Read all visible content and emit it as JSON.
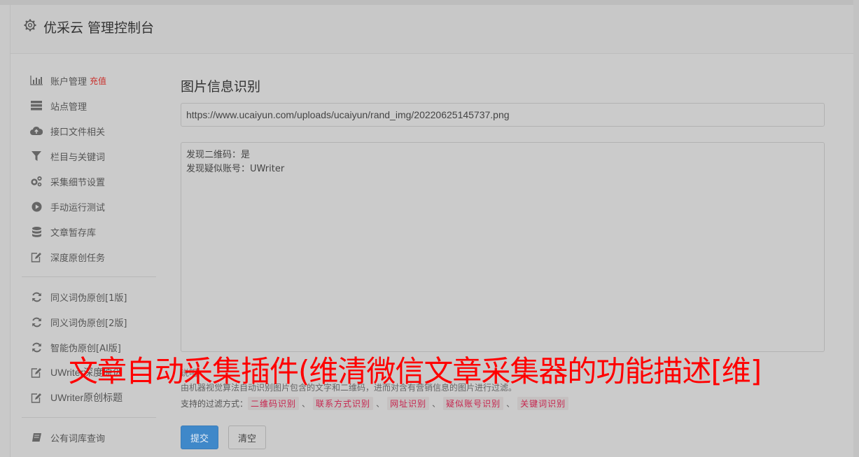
{
  "header": {
    "title": "优采云 管理控制台"
  },
  "sidebar": {
    "items": [
      {
        "label": "账户管理",
        "badge": "充值",
        "icon": "bar-chart-icon"
      },
      {
        "label": "站点管理",
        "icon": "server-icon"
      },
      {
        "label": "接口文件相关",
        "icon": "cloud-upload-icon"
      },
      {
        "label": "栏目与关键词",
        "icon": "filter-icon"
      },
      {
        "label": "采集细节设置",
        "icon": "gears-icon"
      },
      {
        "label": "手动运行测试",
        "icon": "play-circle-icon"
      },
      {
        "label": "文章暂存库",
        "icon": "database-icon"
      },
      {
        "label": "深度原创任务",
        "icon": "edit-icon"
      },
      {
        "label": "同义词伪原创[1版]",
        "icon": "refresh-icon"
      },
      {
        "label": "同义词伪原创[2版]",
        "icon": "refresh-icon"
      },
      {
        "label": "智能伪原创[AI版]",
        "icon": "refresh-icon"
      },
      {
        "label": "UWriter深度原创",
        "icon": "edit-icon"
      },
      {
        "label": "UWriter原创标题",
        "icon": "edit-icon"
      },
      {
        "label": "公有词库查询",
        "icon": "book-icon"
      }
    ]
  },
  "main": {
    "title": "图片信息识别",
    "url_value": "https://www.ucaiyun.com/uploads/ucaiyun/rand_img/20220625145737.png",
    "result_lines": [
      "发现二维码：是",
      "发现疑似账号：UWriter"
    ],
    "desc_label": "说明",
    "desc_text": "由机器视觉算法自动识别图片包含的文字和二维码，进而对含有营销信息的图片进行过滤。",
    "filter_label": "支持的过滤方式：",
    "filter_tags": [
      "二维码识别",
      "联系方式识别",
      "网址识别",
      "疑似账号识别",
      "关键词识别"
    ],
    "filter_sep": "、",
    "submit_label": "提交",
    "clear_label": "清空"
  },
  "watermark": "文章自动采集插件(维清微信文章采集器的功能描述[维]",
  "colors": {
    "primary_button": "#3f88c9",
    "badge_red": "#c9302c",
    "tag_text": "#c7254e",
    "watermark": "#ff0000"
  }
}
